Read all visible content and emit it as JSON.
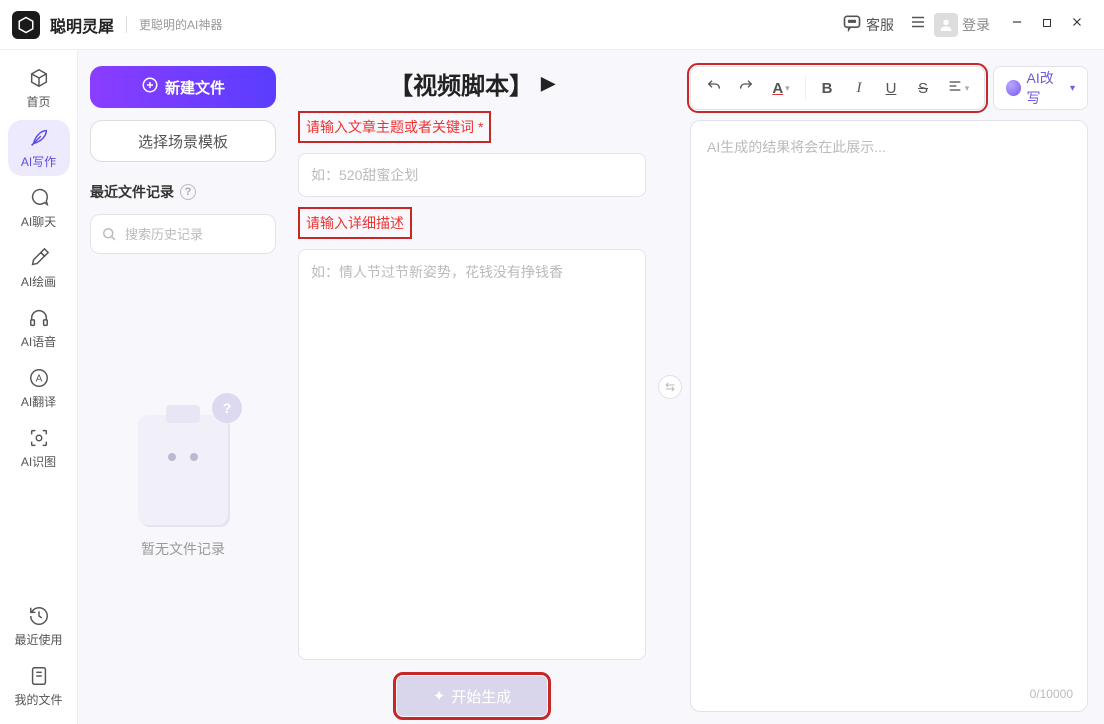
{
  "titlebar": {
    "app_name": "聪明灵犀",
    "tagline": "更聪明的AI神器",
    "support": "客服",
    "login": "登录"
  },
  "sidebar": {
    "items": [
      {
        "label": "首页"
      },
      {
        "label": "AI写作"
      },
      {
        "label": "AI聊天"
      },
      {
        "label": "AI绘画"
      },
      {
        "label": "AI语音"
      },
      {
        "label": "AI翻译"
      },
      {
        "label": "AI识图"
      }
    ],
    "bottom": [
      {
        "label": "最近使用"
      },
      {
        "label": "我的文件"
      }
    ],
    "active_index": 1
  },
  "left_panel": {
    "new_file": "新建文件",
    "choose_template": "选择场景模板",
    "recent_label": "最近文件记录",
    "search_placeholder": "搜索历史记录",
    "empty_text": "暂无文件记录"
  },
  "mid_panel": {
    "title": "【视频脚本】",
    "label_topic": "请输入文章主题或者关键词",
    "required_mark": "*",
    "topic_placeholder": "如：520甜蜜企划",
    "label_detail": "请输入详细描述",
    "detail_placeholder": "如：情人节过节新姿势，花钱没有挣钱香",
    "generate": "开始生成"
  },
  "right_panel": {
    "ai_rewrite": "AI改写",
    "output_placeholder": "AI生成的结果将会在此展示...",
    "counter": "0/10000"
  }
}
